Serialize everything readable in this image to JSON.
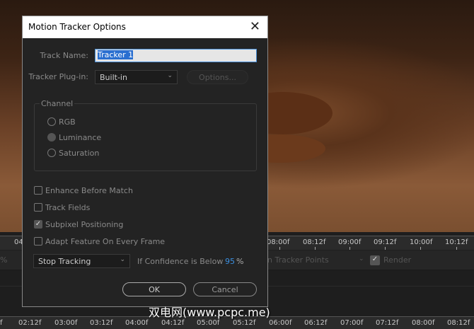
{
  "dialog": {
    "title": "Motion Tracker Options",
    "track_name_label": "Track Name:",
    "track_name_value": "Tracker 1",
    "plugin_label": "Tracker Plug-in:",
    "plugin_value": "Built-in",
    "options_label": "Options...",
    "channel_title": "Channel",
    "channels": [
      {
        "label": "RGB",
        "selected": false
      },
      {
        "label": "Luminance",
        "selected": true
      },
      {
        "label": "Saturation",
        "selected": false
      }
    ],
    "checkboxes": [
      {
        "label": "Enhance Before Match",
        "checked": false
      },
      {
        "label": "Track Fields",
        "checked": false
      },
      {
        "label": "Subpixel Positioning",
        "checked": true
      },
      {
        "label": "Adapt Feature On Every Frame",
        "checked": false
      }
    ],
    "confidence_action": "Stop Tracking",
    "confidence_label": "If Confidence is Below",
    "confidence_value": "95",
    "confidence_unit": "%",
    "ok_label": "OK",
    "cancel_label": "Cancel"
  },
  "timeline": {
    "top_ticks": [
      "04",
      "08:00f",
      "08:12f",
      "09:00f",
      "09:12f",
      "10:00f",
      "10:12f"
    ],
    "bottom_ticks": [
      "f",
      "02:12f",
      "03:00f",
      "03:12f",
      "04:00f",
      "04:12f",
      "05:00f",
      "05:12f",
      "06:00f",
      "06:12f",
      "07:00f",
      "07:12f",
      "08:00f",
      "08:12f"
    ],
    "tracker_points_label": "n Tracker Points",
    "render_label": "Render",
    "pct": "%"
  },
  "watermark": "双电网(www.pcpc.me)"
}
